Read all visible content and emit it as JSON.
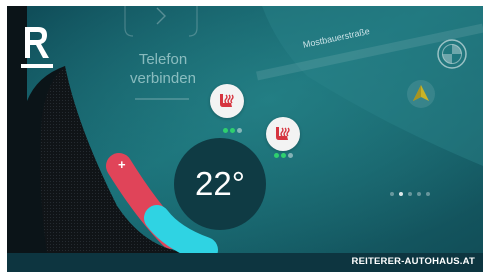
{
  "phone": {
    "label_line1": "Telefon",
    "label_line2": "verbinden"
  },
  "map": {
    "street_name": "Mostbauerstraße"
  },
  "climate": {
    "temperature": "22°",
    "slider_plus_glyph": "+",
    "slider_level": 0.5
  },
  "seat_heating": [
    {
      "icon": "seat-heating-icon",
      "level": 2,
      "max_level": 3
    },
    {
      "icon": "seat-heating-icon",
      "level": 2,
      "max_level": 3
    }
  ],
  "pager": {
    "active_index": 1,
    "count": 5
  },
  "brand": {
    "logo_letter": "R",
    "bmw_letters": "BMW"
  },
  "footer": {
    "text": "REITERER-AUTOHAUS.AT"
  },
  "colors": {
    "accent_red": "#e04459",
    "accent_cyan": "#2fd3e3",
    "level_green": "#2fd06e",
    "screen_teal": "#16616a"
  }
}
